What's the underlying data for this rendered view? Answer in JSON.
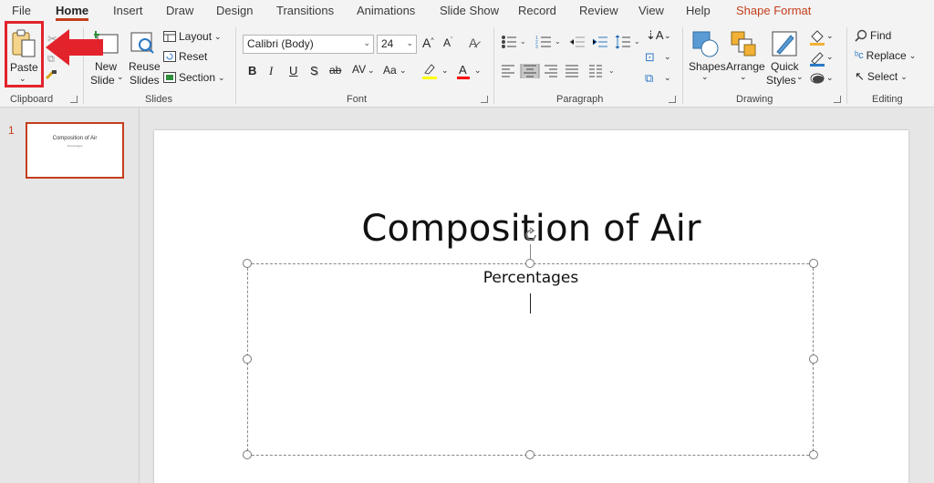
{
  "tabs": [
    "File",
    "Home",
    "Insert",
    "Draw",
    "Design",
    "Transitions",
    "Animations",
    "Slide Show",
    "Record",
    "Review",
    "View",
    "Help",
    "Shape Format"
  ],
  "ribbon": {
    "clipboard": {
      "paste": "Paste",
      "group": "Clipboard"
    },
    "slides": {
      "new_slide_1": "New",
      "new_slide_2": "Slide",
      "reuse_1": "Reuse",
      "reuse_2": "Slides",
      "layout": "Layout",
      "reset": "Reset",
      "section": "Section",
      "group": "Slides"
    },
    "font": {
      "name": "Calibri (Body)",
      "size": "24",
      "group": "Font",
      "bold": "B",
      "italic": "I",
      "underline": "U",
      "shadow": "S",
      "strike": "ab",
      "spacing": "AV",
      "case": "Aa"
    },
    "paragraph": {
      "group": "Paragraph"
    },
    "drawing": {
      "shapes": "Shapes",
      "arrange": "Arrange",
      "quick_1": "Quick",
      "quick_2": "Styles",
      "group": "Drawing"
    },
    "editing": {
      "find": "Find",
      "replace": "Replace",
      "select": "Select",
      "group": "Editing"
    }
  },
  "thumbnail": {
    "number": "1",
    "title": "Composition of Air",
    "subtitle": "Percentages"
  },
  "slide": {
    "title": "Composition of Air",
    "subtitle": "Percentages"
  },
  "colors": {
    "accent": "#c43e1c",
    "callout": "#e3232c",
    "highlight_yellow": "#ffff00",
    "font_red": "#ff0000"
  }
}
